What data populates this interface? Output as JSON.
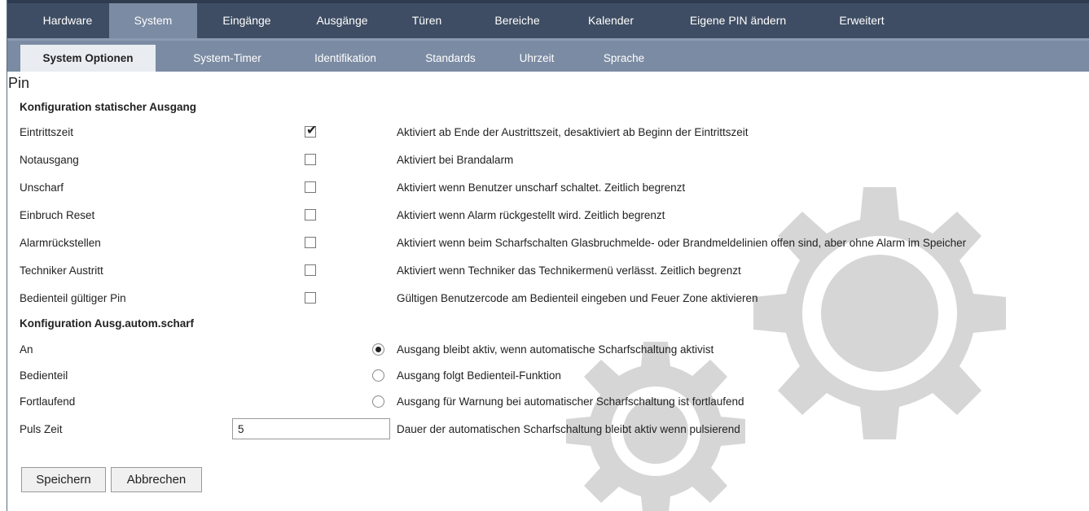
{
  "nav": {
    "tabs": [
      "Hardware",
      "System",
      "Eingänge",
      "Ausgänge",
      "Türen",
      "Bereiche",
      "Kalender",
      "Eigene PIN ändern",
      "Erweitert"
    ],
    "active": "System"
  },
  "subnav": {
    "tabs": [
      "System Optionen",
      "System-Timer",
      "Identifikation",
      "Standards",
      "Uhrzeit",
      "Sprache"
    ],
    "active": "System Optionen"
  },
  "page": {
    "title": "Pin"
  },
  "section1": {
    "title": "Konfiguration statischer Ausgang",
    "rows": [
      {
        "label": "Eintrittszeit",
        "checked": true,
        "desc": "Aktiviert ab Ende der Austrittszeit, desaktiviert ab Beginn der Eintrittszeit"
      },
      {
        "label": "Notausgang",
        "checked": false,
        "desc": "Aktiviert bei Brandalarm"
      },
      {
        "label": "Unscharf",
        "checked": false,
        "desc": "Aktiviert wenn Benutzer unscharf schaltet. Zeitlich begrenzt"
      },
      {
        "label": "Einbruch Reset",
        "checked": false,
        "desc": "Aktiviert wenn Alarm rückgestellt wird. Zeitlich begrenzt"
      },
      {
        "label": "Alarmrückstellen",
        "checked": false,
        "desc": "Aktiviert wenn beim Scharfschalten Glasbruchmelde- oder Brandmeldelinien offen sind, aber ohne Alarm im Speicher"
      },
      {
        "label": "Techniker Austritt",
        "checked": false,
        "desc": "Aktiviert wenn Techniker das Technikermenü verlässt. Zeitlich begrenzt"
      },
      {
        "label": "Bedienteil gültiger Pin",
        "checked": false,
        "desc": "Gültigen Benutzercode am Bedienteil eingeben und Feuer Zone aktivieren"
      }
    ]
  },
  "section2": {
    "title": "Konfiguration Ausg.autom.scharf",
    "options": [
      {
        "label": "An",
        "selected": true,
        "desc": "Ausgang bleibt aktiv, wenn automatische Scharfschaltung aktivist"
      },
      {
        "label": "Bedienteil",
        "selected": false,
        "desc": "Ausgang folgt Bedienteil-Funktion"
      },
      {
        "label": "Fortlaufend",
        "selected": false,
        "desc": "Ausgang für Warnung bei automatischer Scharfschaltung ist fortlaufend"
      }
    ],
    "puls": {
      "label": "Puls Zeit",
      "value": "5",
      "desc": "Dauer der automatischen Scharfschaltung bleibt aktiv wenn pulsierend"
    }
  },
  "buttons": {
    "save": "Speichern",
    "cancel": "Abbrechen"
  },
  "colors": {
    "nav_bg": "#3e4d63",
    "subnav_bg": "#7b8ba3",
    "active_subtab_bg": "#e9edf2",
    "watermark": "#d6d6d6"
  }
}
